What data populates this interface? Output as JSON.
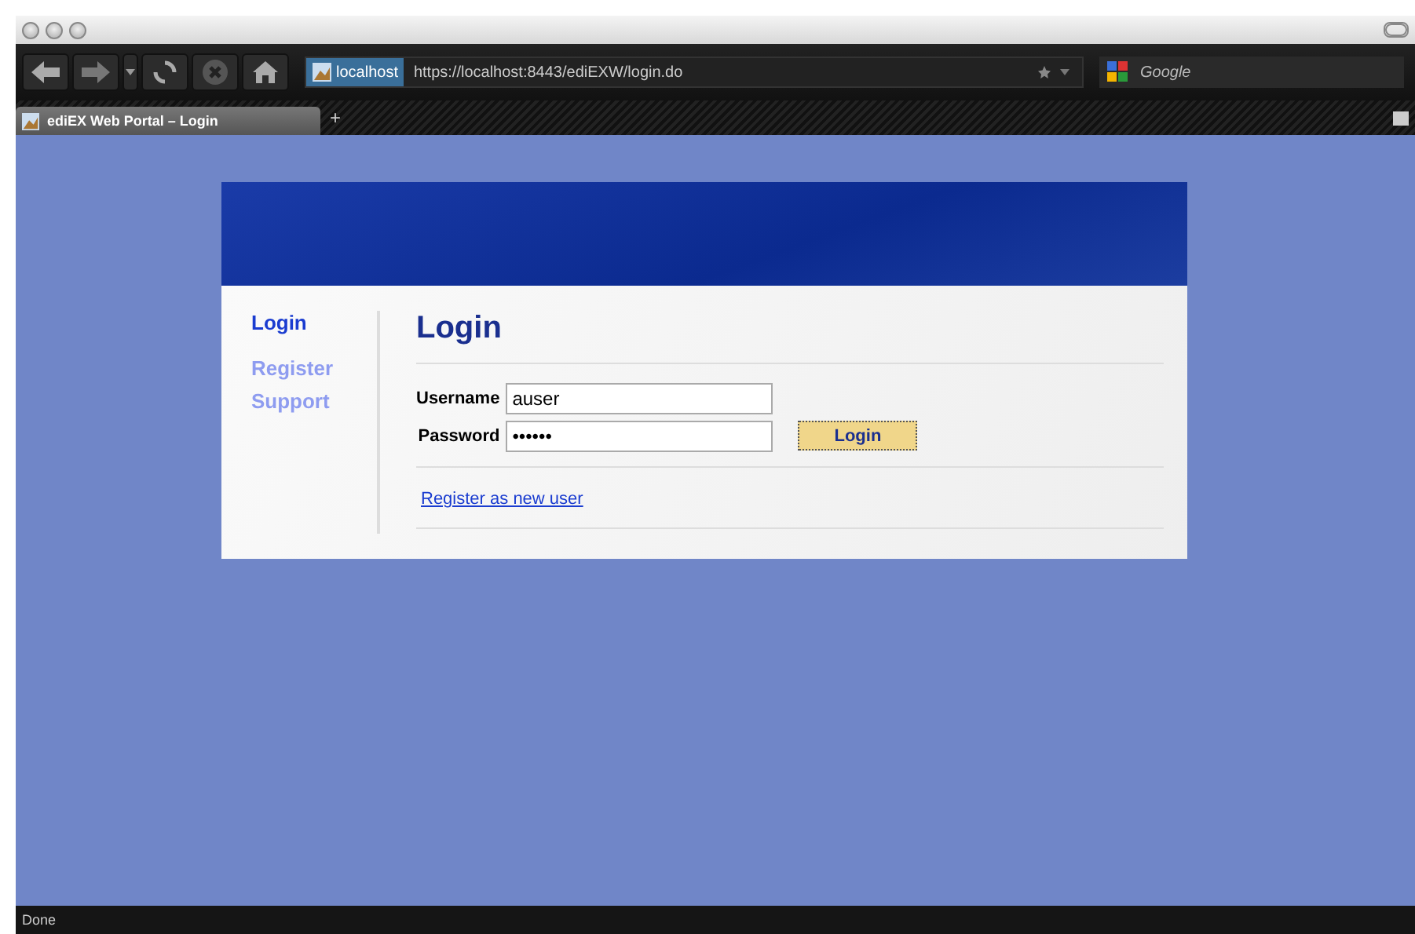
{
  "browser": {
    "address_badge": "localhost",
    "url": "https://localhost:8443/ediEXW/login.do",
    "search_placeholder": "Google",
    "tabs": [
      {
        "label": "ediEX Web Portal – Login",
        "selected": true
      }
    ],
    "new_tab": "+",
    "status": "Done"
  },
  "page": {
    "nav": [
      {
        "label": "Login",
        "selected": true
      },
      {
        "label": "Register",
        "selected": false
      },
      {
        "label": "Support",
        "selected": false
      }
    ],
    "heading": "Login",
    "fields": [
      {
        "label": "Username",
        "value": "auser"
      },
      {
        "label": "Password",
        "value": "••••••"
      }
    ],
    "submit": "Login",
    "link": "Register as new user"
  }
}
